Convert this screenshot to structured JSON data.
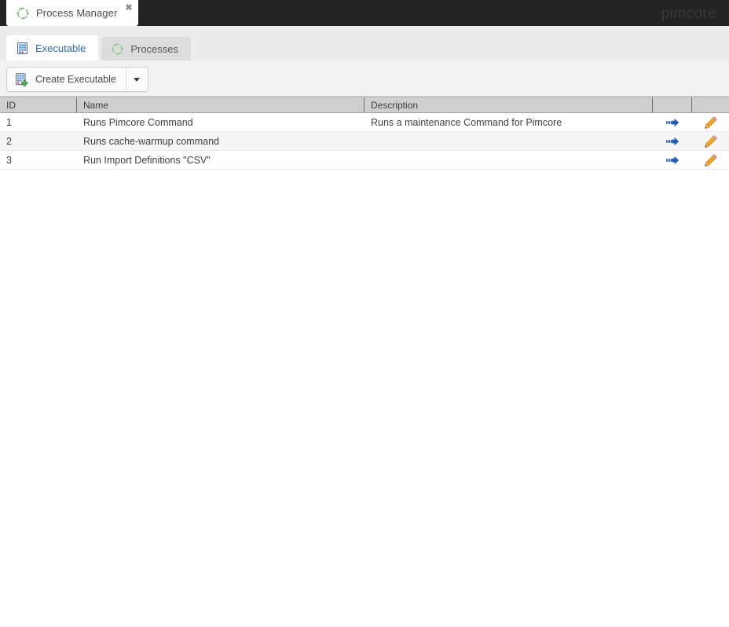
{
  "window": {
    "tab_title": "Process Manager",
    "tab_icon": "process-cycle-icon",
    "close_label": "✖",
    "brand": "pimcore"
  },
  "tabs": [
    {
      "label": "Executable",
      "icon": "executable-building-icon",
      "active": true
    },
    {
      "label": "Processes",
      "icon": "process-cycle-icon",
      "active": false
    }
  ],
  "toolbar": {
    "create_label": "Create Executable",
    "create_icon": "add-executable-icon",
    "menu_icon": "chevron-down-icon"
  },
  "grid": {
    "columns": [
      {
        "key": "id",
        "label": "ID"
      },
      {
        "key": "name",
        "label": "Name"
      },
      {
        "key": "description",
        "label": "Description"
      },
      {
        "key": "run",
        "label": ""
      },
      {
        "key": "edit",
        "label": ""
      }
    ],
    "rows": [
      {
        "id": "1",
        "name": "Runs Pimcore Command",
        "description": "Runs a maintenance Command for Pimcore",
        "run_icon": "run-arrow-icon",
        "edit_icon": "edit-pencil-icon"
      },
      {
        "id": "2",
        "name": "Runs cache-warmup command",
        "description": "",
        "run_icon": "run-arrow-icon",
        "edit_icon": "edit-pencil-icon"
      },
      {
        "id": "3",
        "name": "Run Import Definitions \"CSV\"",
        "description": "",
        "run_icon": "run-arrow-icon",
        "edit_icon": "edit-pencil-icon"
      }
    ]
  },
  "colors": {
    "topbar": "#232323",
    "active_tab_text": "#2b6ba8",
    "header_bg": "#cfcfcf",
    "run_icon": "#1a5fb4",
    "edit_icon": "#f5a623",
    "cycle_icon": "#8dc98d"
  }
}
